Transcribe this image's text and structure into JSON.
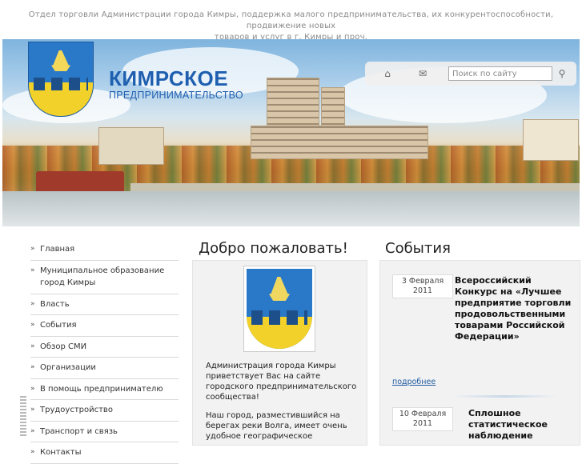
{
  "top_description": {
    "line1": "Отдел торговли Администрации города Кимры, поддержка малого предпринимательства, их конкурентоспособности, продвижение новых",
    "line2": "товаров и услуг в г. Кимры и проч."
  },
  "brand": {
    "title": "КИМРСКОЕ",
    "subtitle": "ПРЕДПРИНИМАТЕЛЬСТВО"
  },
  "header_tools": {
    "home_icon": "home-icon",
    "mail_icon": "mail-icon",
    "search_placeholder": "Поиск по сайту",
    "search_icon": "magnifier-icon"
  },
  "nav": [
    "Главная",
    "Муниципальное образование город Кимры",
    "Власть",
    "События",
    "Обзор СМИ",
    "Организации",
    "В помощь предпринимателю",
    "Трудоустройство",
    "Транспорт и связь",
    "Контакты"
  ],
  "welcome": {
    "heading": "Добро пожаловать!",
    "paragraph1": "Администрация города Кимры приветствует Вас на сайте городского предпринимательского сообщества!",
    "paragraph2": "Наш город, разместившийся на берегах реки Волга, имеет очень удобное географическое"
  },
  "events": {
    "heading": "События",
    "items": [
      {
        "date_day": "3 Февраля",
        "date_year": "2011",
        "title": "Всероссийский Конкурс на «Лучшее предприятие торговли продовольственными товарами Российской Федерации»",
        "more": "подробнее"
      },
      {
        "date_day": "10 Февраля",
        "date_year": "2011",
        "title": "Сплошное статистическое наблюдение"
      }
    ]
  },
  "colors": {
    "brand_blue": "#1f5fb0",
    "link_blue": "#1e5aa0",
    "crest_blue": "#2a78c8",
    "crest_gold": "#f1d12a"
  }
}
